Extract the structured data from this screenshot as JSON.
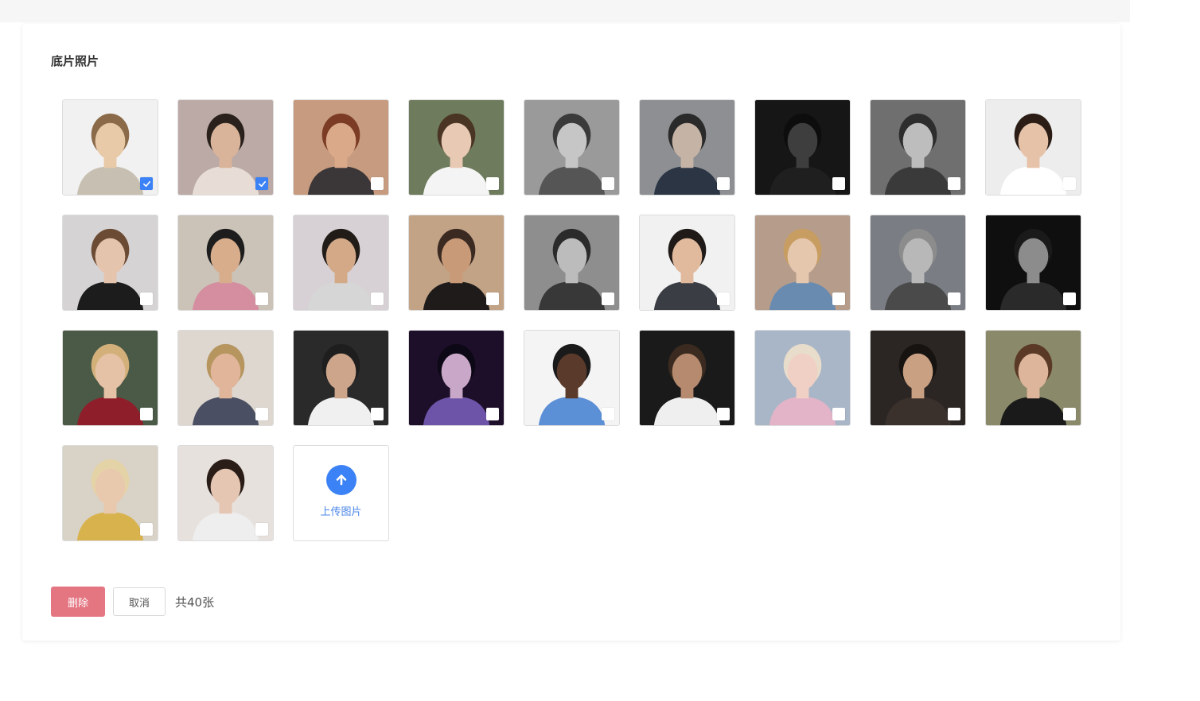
{
  "panel": {
    "title": "底片照片"
  },
  "photos": [
    {
      "bg": "#f1f1f1",
      "face": "#e8c9a8",
      "hair": "#8a6a48",
      "shirt": "#c7c0b2",
      "checked": true
    },
    {
      "bg": "#bcaaa6",
      "face": "#d9b49a",
      "hair": "#2a211c",
      "shirt": "#e7ddd6",
      "checked": true
    },
    {
      "bg": "#c79b7f",
      "face": "#d9a98a",
      "hair": "#7b3b25",
      "shirt": "#3b3638",
      "checked": false
    },
    {
      "bg": "#6e7b5c",
      "face": "#e8c9b4",
      "hair": "#4a3524",
      "shirt": "#f4f4f4",
      "checked": false
    },
    {
      "bg": "#9a9a9a",
      "face": "#c6c6c6",
      "hair": "#3a3a3a",
      "shirt": "#555555",
      "checked": false
    },
    {
      "bg": "#8d8f92",
      "face": "#c5b3a6",
      "hair": "#2a2a2a",
      "shirt": "#2b3544",
      "checked": false
    },
    {
      "bg": "#161616",
      "face": "#3e3e3e",
      "hair": "#0d0d0d",
      "shirt": "#1f1f1f",
      "checked": false
    },
    {
      "bg": "#6f6f6f",
      "face": "#bdbdbd",
      "hair": "#2d2d2d",
      "shirt": "#3a3a3a",
      "checked": false
    },
    {
      "bg": "#ededed",
      "face": "#e6c3a8",
      "hair": "#2b1d16",
      "shirt": "#ffffff",
      "checked": false
    },
    {
      "bg": "#d6d3d4",
      "face": "#e5c4ae",
      "hair": "#6b4b34",
      "shirt": "#1c1c1c",
      "checked": false
    },
    {
      "bg": "#cbc3b8",
      "face": "#d7ad8c",
      "hair": "#1d1d1d",
      "shirt": "#d48ea0",
      "checked": false
    },
    {
      "bg": "#d7d1d5",
      "face": "#d3a988",
      "hair": "#221c18",
      "shirt": "#d6d6d6",
      "checked": false
    },
    {
      "bg": "#c2a386",
      "face": "#c99a78",
      "hair": "#3a2a22",
      "shirt": "#1e1b1a",
      "checked": false
    },
    {
      "bg": "#8e8e8e",
      "face": "#bcbcbc",
      "hair": "#2b2b2b",
      "shirt": "#383838",
      "checked": false
    },
    {
      "bg": "#f1f1f1",
      "face": "#e1b99c",
      "hair": "#1f1a17",
      "shirt": "#3a3d44",
      "checked": false
    },
    {
      "bg": "#b69c8a",
      "face": "#e5c7ae",
      "hair": "#c89d62",
      "shirt": "#6a8bb0",
      "checked": false
    },
    {
      "bg": "#7a7e84",
      "face": "#b8b8b8",
      "hair": "#8c8c8c",
      "shirt": "#4a4a4a",
      "checked": false
    },
    {
      "bg": "#0f0f0f",
      "face": "#8c8c8c",
      "hair": "#1a1a1a",
      "shirt": "#2a2a2a",
      "checked": false
    },
    {
      "bg": "#4a5a46",
      "face": "#e5c2a6",
      "hair": "#d3b07a",
      "shirt": "#8e1f2a",
      "checked": false
    },
    {
      "bg": "#ddd7d0",
      "face": "#e0b59a",
      "hair": "#b6955f",
      "shirt": "#4a4f63",
      "checked": false
    },
    {
      "bg": "#2a2a2a",
      "face": "#cda58a",
      "hair": "#1e1e1e",
      "shirt": "#f0f0f0",
      "checked": false
    },
    {
      "bg": "#1d0f2a",
      "face": "#c9a7c8",
      "hair": "#0d0815",
      "shirt": "#6e54a8",
      "checked": false
    },
    {
      "bg": "#f4f4f4",
      "face": "#5a3a2b",
      "hair": "#1a1a1a",
      "shirt": "#5b8fd6",
      "checked": false
    },
    {
      "bg": "#1a1a1a",
      "face": "#b58a6e",
      "hair": "#3a2a1f",
      "shirt": "#efefef",
      "checked": false
    },
    {
      "bg": "#a9b6c8",
      "face": "#f0d0c4",
      "hair": "#e8dccb",
      "shirt": "#e3b4c7",
      "checked": false
    },
    {
      "bg": "#2b2623",
      "face": "#caa083",
      "hair": "#171311",
      "shirt": "#3a302c",
      "checked": false
    },
    {
      "bg": "#8a8a6a",
      "face": "#dcb59a",
      "hair": "#5a3a26",
      "shirt": "#1a1a1a",
      "checked": false
    },
    {
      "bg": "#d8d2c7",
      "face": "#e8c9ae",
      "hair": "#e5d3a8",
      "shirt": "#d8b24c",
      "checked": false
    },
    {
      "bg": "#e7e1dd",
      "face": "#e5c6b3",
      "hair": "#2a1d18",
      "shirt": "#eeeeee",
      "checked": false
    }
  ],
  "upload": {
    "label": "上传图片"
  },
  "footer": {
    "delete_label": "删除",
    "cancel_label": "取消",
    "count_text": "共40张"
  }
}
